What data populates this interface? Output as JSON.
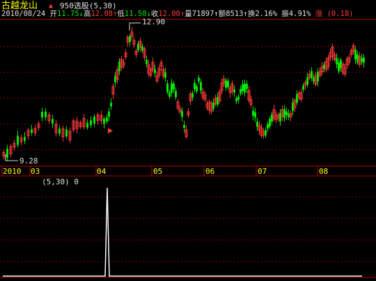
{
  "header": {
    "stock_name": "古越龙山",
    "indicator": "950选股(5,30)",
    "date": "2010/08/24",
    "open_label": "开",
    "open_value": "11.75",
    "high_label": "高",
    "high_value": "12.08",
    "low_label": "低",
    "low_value": "11.50",
    "close_label": "收",
    "close_value": "12.00",
    "volume_label": "量",
    "volume_value": "71897",
    "amount_label": "额",
    "amount_value": "8513",
    "turnover_label": "换",
    "turnover_value": "2.16%",
    "amplitude_label": "振",
    "amplitude_value": "4.91%",
    "change_label": "涨",
    "change_value": "(0.18)"
  },
  "annotations": {
    "max_price": "12.90",
    "min_price": "9.28"
  },
  "axis_labels": {
    "year": "2010",
    "m03": "03",
    "m04": "04",
    "m05": "05",
    "m06": "06",
    "m07": "07",
    "m08": "08"
  },
  "subchart": {
    "label": "(5,30)",
    "value": "0"
  },
  "colors": {
    "up": "#ff3a3a",
    "down": "#00e800",
    "grid": "#8a0000",
    "label_yellow": "#ffff00",
    "label_white": "#e0e0e0"
  },
  "chart_data": {
    "type": "line",
    "series": [
      {
        "values": [
          0,
          0,
          0,
          0,
          0,
          0,
          0,
          0,
          0,
          0,
          0,
          0,
          0,
          0,
          0,
          0,
          0,
          0,
          0,
          0,
          0,
          0,
          0,
          0,
          0,
          0,
          0,
          0,
          0,
          0,
          0,
          0,
          0,
          0,
          0,
          0,
          0,
          0,
          0,
          0,
          0,
          0,
          0,
          0,
          0,
          0,
          0,
          0,
          0,
          0,
          1,
          0,
          0,
          0,
          0,
          0,
          0,
          0,
          0,
          0,
          0,
          0,
          0,
          0,
          0,
          0,
          0,
          0,
          0,
          0,
          0,
          0,
          0,
          0,
          0,
          0,
          0,
          0,
          0,
          0,
          0,
          0,
          0,
          0,
          0,
          0,
          0,
          0,
          0,
          0,
          0,
          0,
          0,
          0,
          0,
          0,
          0,
          0,
          0,
          0,
          0,
          0,
          0,
          0,
          0,
          0,
          0,
          0,
          0,
          0,
          0,
          0,
          0,
          0,
          0,
          0,
          0,
          0,
          0,
          0,
          0,
          0,
          0,
          0,
          0,
          0,
          0,
          0,
          0,
          0,
          0,
          0,
          0,
          0,
          0,
          0,
          0,
          0,
          0,
          0,
          0,
          0,
          0,
          0,
          0,
          0,
          0,
          0,
          0,
          0,
          0,
          0,
          0,
          0,
          0,
          0,
          0,
          0,
          0,
          0,
          0,
          0,
          0,
          0,
          0,
          0,
          0,
          0,
          0,
          0,
          0,
          0,
          0
        ]
      }
    ]
  }
}
